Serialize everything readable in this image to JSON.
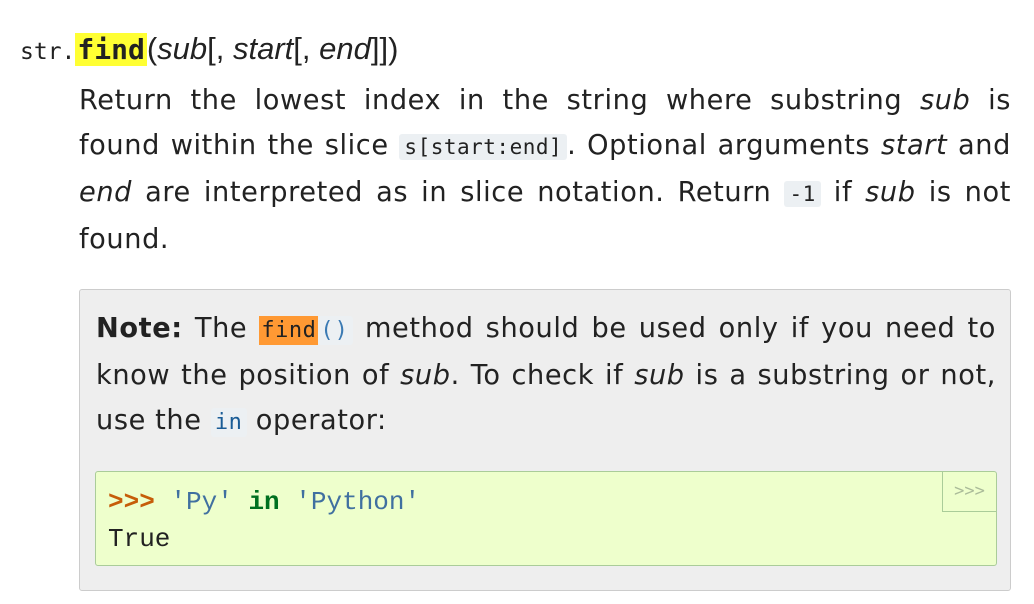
{
  "signature": {
    "prefix": "str.",
    "name": "find",
    "open": "(",
    "p_sub": "sub",
    "sep1": "[, ",
    "p_start": "start",
    "sep2": "[, ",
    "p_end": "end",
    "close": "]])"
  },
  "description": {
    "t1": "Return the lowest index in the string where substring ",
    "sub1": "sub",
    "t2": " is found within the slice ",
    "code_slice": "s[start:end]",
    "t3": ". Optional arguments ",
    "start": "start",
    "t4": " and ",
    "end": "end",
    "t5": " are interpreted as in slice notation. Return ",
    "code_minus1": "-1",
    "t6": " if ",
    "sub2": "sub",
    "t7": " is not found."
  },
  "note": {
    "label": "Note:",
    "t1": " The ",
    "code_find": "find",
    "code_parens": "()",
    "t2": " method should be used only if you need to know the position of ",
    "sub1": "sub",
    "t3": ". To check if ",
    "sub2": "sub",
    "t4": " is a substring or not, use the ",
    "code_in": "in",
    "t5": " operator:"
  },
  "example": {
    "prompt": ">>>",
    "str1": "'Py'",
    "op": "in",
    "str2": "'Python'",
    "output": "True",
    "copy_button": ">>>"
  },
  "colors": {
    "search_highlight": "#ffff33",
    "note_highlight": "#ff9933",
    "note_background": "#eeeeee",
    "example_background": "#eeffcc"
  }
}
